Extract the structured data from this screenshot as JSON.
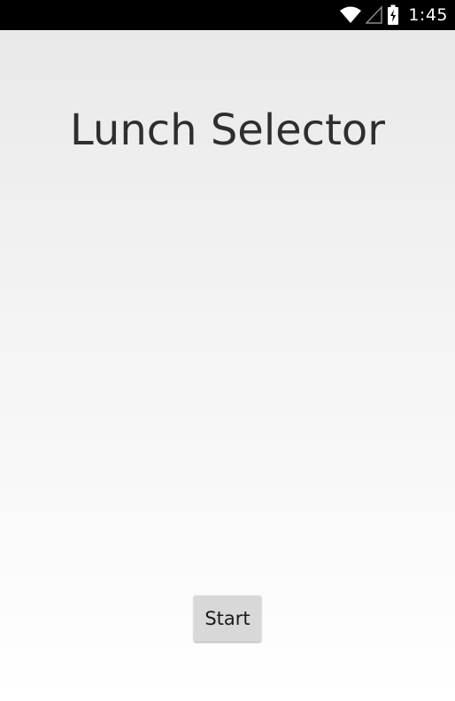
{
  "status_bar": {
    "time": "1:45",
    "icons": [
      "wifi-icon",
      "cell-signal-icon",
      "battery-charging-icon"
    ]
  },
  "main": {
    "title": "Lunch Selector",
    "start_button_label": "Start"
  },
  "colors": {
    "status_bar_bg": "#000000",
    "title_text": "#2e2e2e",
    "button_bg": "#d8d8d8"
  }
}
